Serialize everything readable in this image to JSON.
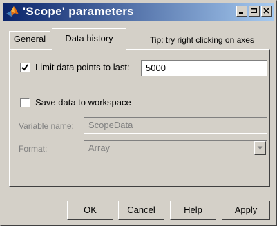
{
  "window": {
    "title": "'Scope' parameters"
  },
  "tabs": [
    {
      "label": "General",
      "active": false
    },
    {
      "label": "Data history",
      "active": true
    }
  ],
  "tip": "Tip: try right clicking on axes",
  "limit_data": {
    "label": "Limit data points to last:",
    "checked": true,
    "value": "5000"
  },
  "save_workspace": {
    "label": "Save data to workspace",
    "checked": false
  },
  "variable_name": {
    "label": "Variable name:",
    "value": "ScopeData",
    "enabled": false
  },
  "format": {
    "label": "Format:",
    "value": "Array",
    "enabled": false
  },
  "buttons": {
    "ok": "OK",
    "cancel": "Cancel",
    "help": "Help",
    "apply": "Apply"
  },
  "colors": {
    "titlebar_start": "#0a246a",
    "titlebar_end": "#a6caf0",
    "face": "#d4d0c8",
    "disabled_text": "#808080"
  },
  "icons": {
    "title": "matlab-logo-icon",
    "minimize": "minimize-icon",
    "maximize": "maximize-icon",
    "close": "close-icon",
    "check": "checkmark-icon",
    "dropdown": "chevron-down-icon"
  }
}
